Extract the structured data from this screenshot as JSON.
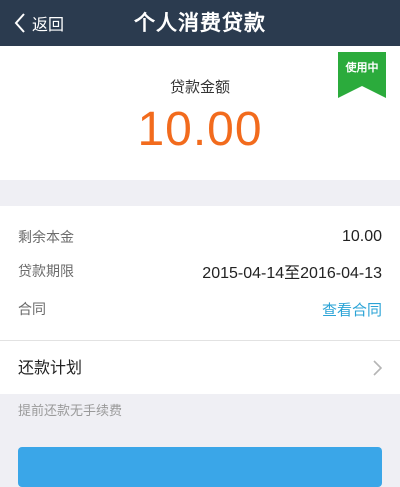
{
  "navbar": {
    "back_label": "返回",
    "title": "个人消费贷款"
  },
  "loan": {
    "status_badge": "使用中",
    "amount_label": "贷款金额",
    "amount_value": "10.00"
  },
  "details": {
    "rows": [
      {
        "label": "剩余本金",
        "value": "10.00"
      },
      {
        "label": "贷款期限",
        "value": "2015-04-14至2016-04-13"
      },
      {
        "label": "合同",
        "value": "查看合同"
      }
    ]
  },
  "repayment_plan": {
    "label": "还款计划",
    "chevron_icon": "chevron-right-icon"
  },
  "note": "提前还款无手续费",
  "colors": {
    "navbar": "#2b3b4f",
    "amount": "#f26b1d",
    "badge": "#2bab3c",
    "link": "#2aa3d6",
    "button": "#3aa6e8"
  }
}
